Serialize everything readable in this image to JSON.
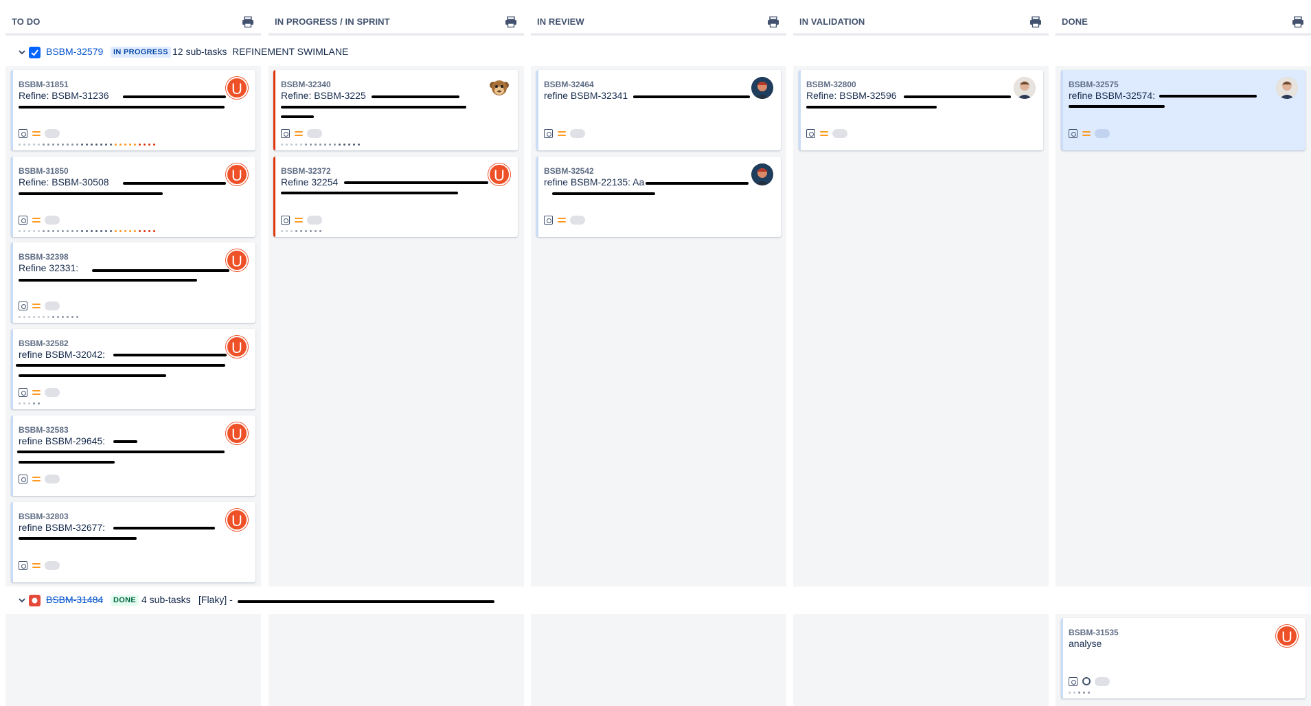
{
  "columns": [
    {
      "title": "TO DO"
    },
    {
      "title": "IN PROGRESS / IN SPRINT"
    },
    {
      "title": "IN REVIEW"
    },
    {
      "title": "IN VALIDATION"
    },
    {
      "title": "DONE"
    }
  ],
  "icons": {
    "print": "printer-icon",
    "story": "story-icon",
    "priority": "priority-medium-icon",
    "collapse": "chevron-down-icon"
  },
  "colors": {
    "accent": "#0052cc",
    "avatar_u": "#ee5128",
    "column_bg": "#f4f5f7",
    "selected_card": "#deebff"
  },
  "swimlanes": [
    {
      "key": "BSBM-32579",
      "status": "IN PROGRESS",
      "count": "12 sub-tasks",
      "summary": "REFINEMENT SWIMLANE"
    },
    {
      "key": "BSBM-31484",
      "status": "DONE",
      "count": "4 sub-tasks",
      "summary": "[Flaky] -"
    }
  ],
  "cards": {
    "todo": [
      {
        "key": "BSBM-31851",
        "summary": "Refine: BSBM-31236",
        "avatar": "U"
      },
      {
        "key": "BSBM-31850",
        "summary": "Refine: BSBM-30508",
        "avatar": "U"
      },
      {
        "key": "BSBM-32398",
        "summary": "Refine 32331:",
        "avatar": "U"
      },
      {
        "key": "BSBM-32582",
        "summary": "refine BSBM-32042:",
        "avatar": "U"
      },
      {
        "key": "BSBM-32583",
        "summary": "refine BSBM-29645:",
        "avatar": "U"
      },
      {
        "key": "BSBM-32803",
        "summary": "refine BSBM-32677:",
        "avatar": "U"
      }
    ],
    "in_progress": [
      {
        "key": "BSBM-32340",
        "summary": "Refine: BSBM-3225"
      },
      {
        "key": "BSBM-32372",
        "summary": "Refine 32254",
        "avatar": "U"
      }
    ],
    "in_review": [
      {
        "key": "BSBM-32464",
        "summary": "refine BSBM-32341"
      },
      {
        "key": "BSBM-32542",
        "summary": "refine BSBM-22135: Aa"
      }
    ],
    "in_validation": [
      {
        "key": "BSBM-32800",
        "summary": "Refine: BSBM-32596"
      }
    ],
    "done": [
      {
        "key": "BSBM-32575",
        "summary": "refine BSBM-32574:"
      },
      {
        "key": "BSBM-31535",
        "summary": "analyse",
        "avatar": "U"
      }
    ]
  }
}
